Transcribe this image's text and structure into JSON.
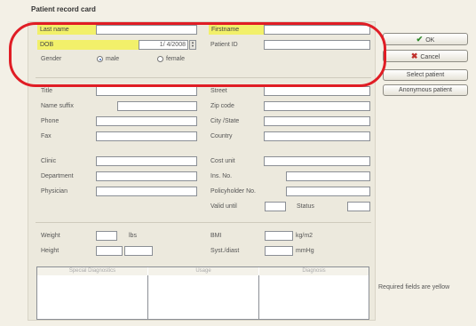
{
  "window": {
    "title": "Patient record card"
  },
  "buttons": {
    "ok": "OK",
    "cancel": "Cancel",
    "select_patient": "Select patient",
    "anonymous_patient": "Anonymous patient"
  },
  "fields": {
    "last_name": "Last name",
    "first_name": "Firstname",
    "dob": "DOB",
    "dob_value": "1/ 4/2008",
    "patient_id": "Patient ID",
    "gender": "Gender",
    "male": "male",
    "female": "female",
    "title": "Title",
    "name_suffix": "Name suffix",
    "phone": "Phone",
    "fax": "Fax",
    "clinic": "Clinic",
    "department": "Department",
    "physician": "Physician",
    "street": "Street",
    "zip_code": "Zip code",
    "city_state": "City /State",
    "country": "Country",
    "cost_unit": "Cost unit",
    "ins_no": "Ins. No.",
    "policyholder_no": "Policyholder No.",
    "valid_until": "Valid until",
    "status": "Status",
    "weight": "Weight",
    "weight_unit": "lbs",
    "height": "Height",
    "bmi": "BMI",
    "bmi_unit": "kg/m2",
    "syst_diast": "Syst./diast",
    "bp_unit": "mmHg"
  },
  "grid_headers": [
    "Special Diagnostics",
    "Usage",
    "Diagnosis"
  ],
  "footer_note": "Required fields are yellow",
  "colors": {
    "required": "#f2f06a",
    "highlight_oval": "#e01d25",
    "ok_check": "#2f8a2a",
    "cancel_x": "#c0302b"
  },
  "icons": {
    "ok": "check-icon",
    "cancel": "x-icon"
  }
}
